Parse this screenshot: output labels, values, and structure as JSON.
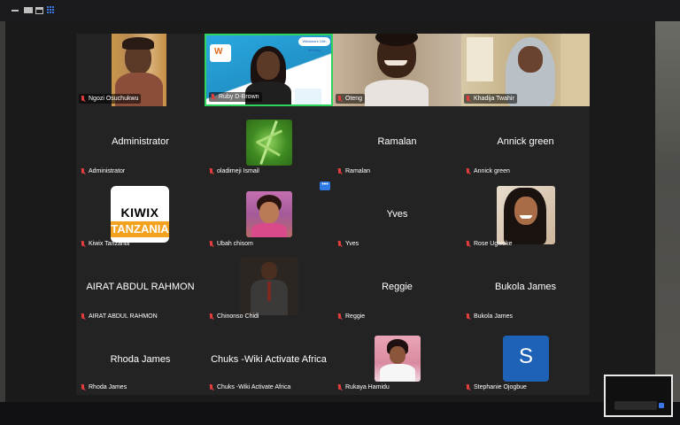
{
  "window": {
    "accent": "#3b78e7"
  },
  "grid": {
    "active_speaker_color": "#2fd25a",
    "more_button_label": "•••",
    "participants": [
      {
        "name": "Ngozi Osuchukwu",
        "display": "video"
      },
      {
        "name": "Ruby D-Brown",
        "display": "video",
        "active": true,
        "banner_text": "Wikidata's 10th Birthday"
      },
      {
        "name": "Oteng",
        "display": "video"
      },
      {
        "name": "Khadija Twahir",
        "display": "video"
      },
      {
        "name": "Administrator",
        "display": "name",
        "center_text": "Administrator"
      },
      {
        "name": "oladimeji Ismail",
        "display": "image"
      },
      {
        "name": "Ramalan",
        "display": "name",
        "center_text": "Ramalan"
      },
      {
        "name": "Annick green",
        "display": "name",
        "center_text": "Annick green"
      },
      {
        "name": "Kiwix Tanzania",
        "display": "logo",
        "logo_line1": "KIWIX",
        "logo_line2": "TANZANIA"
      },
      {
        "name": "Ubah chisom",
        "display": "image"
      },
      {
        "name": "Yves",
        "display": "name",
        "center_text": "Yves"
      },
      {
        "name": "Rose Ugwoke",
        "display": "image"
      },
      {
        "name": "AIRAT ABDUL RAHMON",
        "display": "name",
        "center_text": "AIRAT ABDUL RAHMON"
      },
      {
        "name": "Chinonso Chidi",
        "display": "image"
      },
      {
        "name": "Reggie",
        "display": "name",
        "center_text": "Reggie"
      },
      {
        "name": "Bukola James",
        "display": "name",
        "center_text": "Bukola James"
      },
      {
        "name": "Rhoda James",
        "display": "name",
        "center_text": "Rhoda James"
      },
      {
        "name": "Chuks -Wiki Activate Africa",
        "display": "name",
        "center_text": "Chuks -Wiki Activate Africa"
      },
      {
        "name": "Rukaya Hamidu",
        "display": "image"
      },
      {
        "name": "Stephanie Ojogbue",
        "display": "avatar",
        "initial": "S"
      }
    ]
  }
}
